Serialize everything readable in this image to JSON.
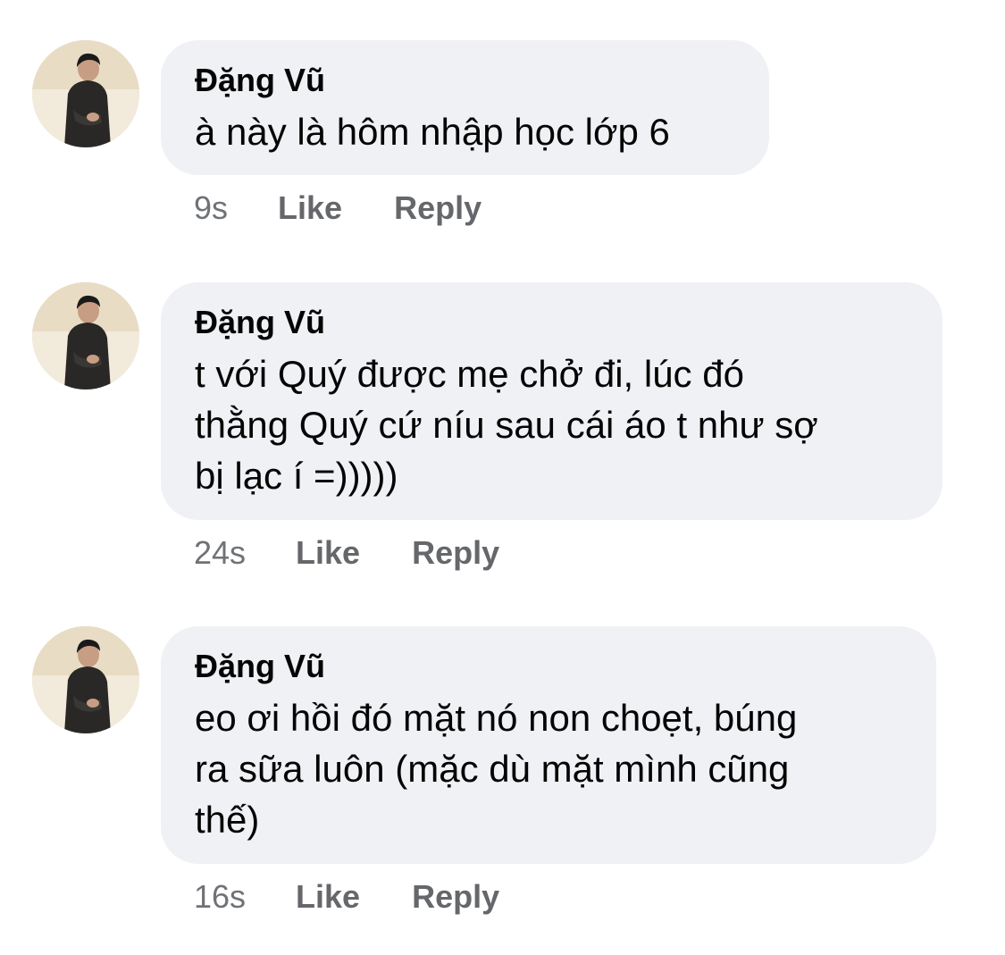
{
  "comments": [
    {
      "author": "Đặng Vũ",
      "text": "à này là hôm nhập học lớp 6",
      "time": "9s",
      "like_label": "Like",
      "reply_label": "Reply"
    },
    {
      "author": "Đặng Vũ",
      "text": "t với Quý được mẹ chở đi, lúc đó\nthằng Quý cứ níu sau cái áo t như sợ\nbị lạc í =)))))",
      "time": "24s",
      "like_label": "Like",
      "reply_label": "Reply"
    },
    {
      "author": "Đặng Vũ",
      "text": "eo ơi hồi đó mặt nó non choẹt, búng\nra sữa luôn (mặc dù mặt mình cũng\nthế)",
      "time": "16s",
      "like_label": "Like",
      "reply_label": "Reply"
    }
  ],
  "colors": {
    "bubble": "#f0f1f4",
    "text": "#050505",
    "meta": "#65676b"
  }
}
